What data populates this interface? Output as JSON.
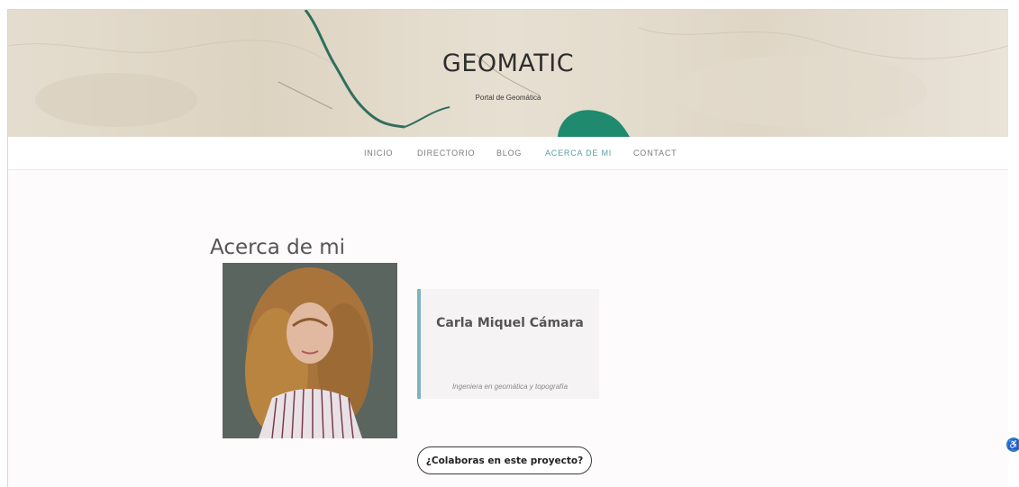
{
  "header": {
    "site_title": "GEOMATIC",
    "tagline": "Portal de Geomática"
  },
  "nav": {
    "items": [
      {
        "label": "INICIO"
      },
      {
        "label": "DIRECTORIO"
      },
      {
        "label": "BLOG"
      },
      {
        "label": "ACERCA DE MI",
        "active": true
      },
      {
        "label": "CONTACT"
      }
    ]
  },
  "main": {
    "heading": "Acerca de mi",
    "profile": {
      "name": "Carla Miquel Cámara",
      "role": "Ingeniera en geomática y topografía"
    },
    "collab_button": "¿Colaboras en este proyecto?"
  },
  "colors": {
    "accent": "#7fb3be",
    "active_nav": "#5c9ca6",
    "river": "#2f6e5e",
    "water": "#1f8a6e"
  },
  "icons": {
    "accessibility": "accessibility-icon"
  }
}
